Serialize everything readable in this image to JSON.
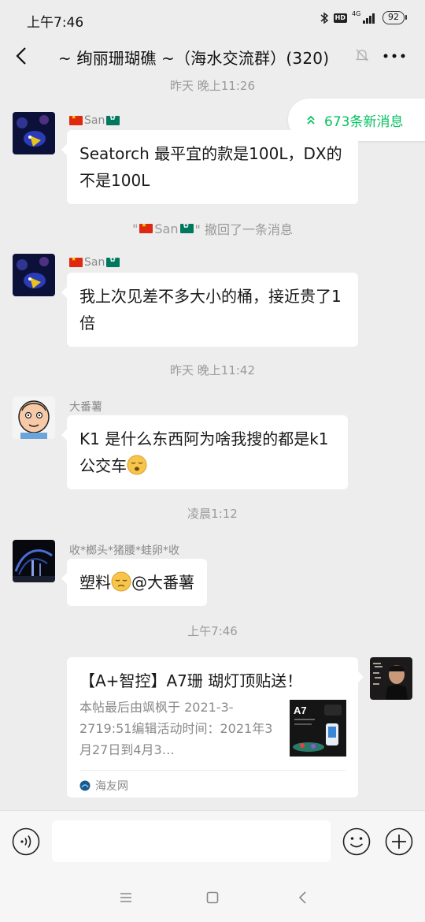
{
  "status_bar": {
    "time": "上午7:46",
    "network": "4G",
    "battery": "92"
  },
  "nav": {
    "title": "~ 绚丽珊瑚礁 ~（海水交流群）(320)"
  },
  "new_messages": {
    "label": "673条新消息"
  },
  "timestamps": {
    "t1": "昨天 晚上11:26",
    "t2": "昨天 晚上11:42",
    "t3": "凌晨1:12",
    "t4": "上午7:46"
  },
  "messages": [
    {
      "sender": "San",
      "text": "Seatorch 最平宜的款是100L，DX的不是100L"
    },
    {
      "sender": "San",
      "text": "我上次见差不多大小的桶，接近贵了1倍"
    },
    {
      "sender": "大番薯",
      "text": "K1 是什么东西阿为啥我搜的都是k1 公交车"
    },
    {
      "sender": "收*榔头*猪腰*蛙卵*收",
      "text_before": "塑料",
      "text_after": "@大番薯"
    }
  ],
  "recall": {
    "prefix": "\"",
    "name": "San",
    "suffix": "\" 撤回了一条消息"
  },
  "link_card": {
    "title": "【A+智控】A7珊 瑚灯顶贴送！",
    "desc": "本帖最后由飒枫于 2021-3-2719:51编辑活动时间：2021年3月27日到4月3…",
    "thumb_label": "A7",
    "source": "海友网"
  },
  "input": {
    "placeholder": ""
  },
  "colors": {
    "accent": "#07c160",
    "background": "#ededed",
    "bubble": "#ffffff"
  }
}
